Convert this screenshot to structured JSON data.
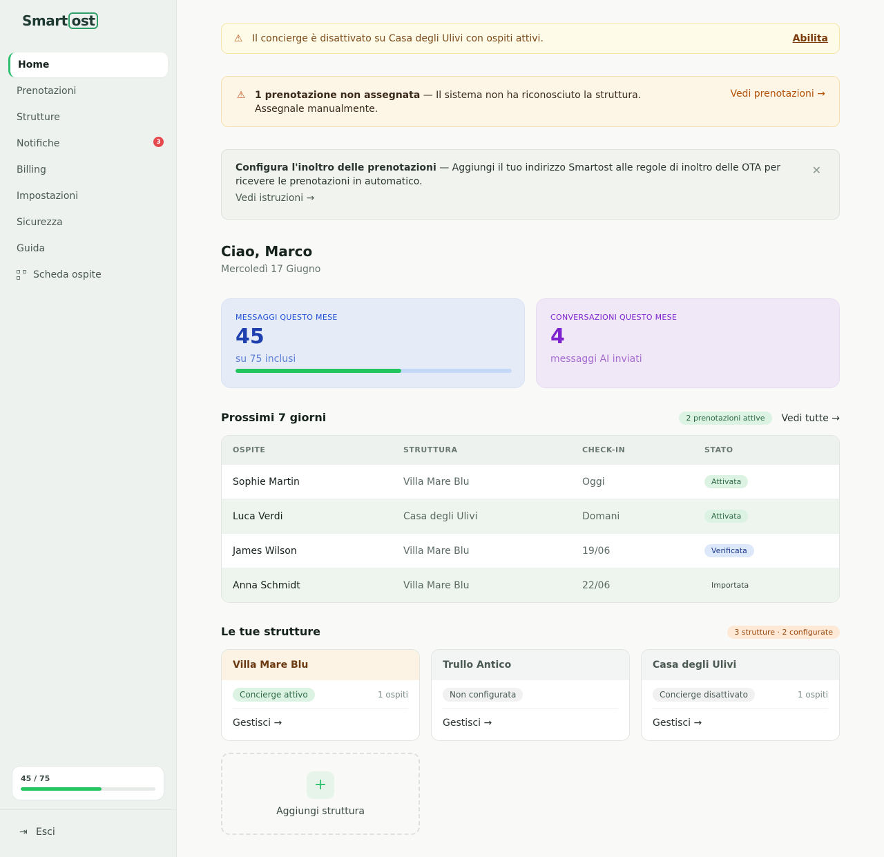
{
  "brand": {
    "name_part1": "Smart",
    "name_part2": "ost"
  },
  "sidebar": {
    "items": [
      {
        "label": "Home"
      },
      {
        "label": "Prenotazioni"
      },
      {
        "label": "Strutture"
      },
      {
        "label": "Notifiche",
        "badge": "3"
      },
      {
        "label": "Billing"
      },
      {
        "label": "Impostazioni"
      },
      {
        "label": "Sicurezza"
      },
      {
        "label": "Guida"
      },
      {
        "label": "Scheda ospite",
        "icon": "qr-code-icon"
      }
    ],
    "usage": {
      "label": "45 / 75",
      "used": 45,
      "total": 75
    },
    "logout_label": "Esci"
  },
  "alerts": {
    "concierge": {
      "text": "Il concierge è disattivato su Casa degli Ulivi con ospiti attivi.",
      "action": "Abilita"
    },
    "unassigned": {
      "bold": "1 prenotazione non assegnata",
      "text": " — Il sistema non ha riconosciuto la struttura. Assegnale manualmente.",
      "action": "Vedi prenotazioni →"
    },
    "forwarding": {
      "bold": "Configura l'inoltro delle prenotazioni",
      "text": " — Aggiungi il tuo indirizzo Smartost alle regole di inoltro delle OTA per ricevere le prenotazioni in automatico.",
      "action": "Vedi istruzioni →"
    }
  },
  "greeting": {
    "title": "Ciao, Marco",
    "date": "Mercoledì 17 Giugno"
  },
  "stats": {
    "messages": {
      "label": "MESSAGGI QUESTO MESE",
      "value": "45",
      "sub": "su 75 inclusi",
      "fraction": 0.6
    },
    "conversations": {
      "label": "CONVERSAZIONI QUESTO MESE",
      "value": "4",
      "sub": "messaggi AI inviati"
    }
  },
  "upcoming": {
    "title": "Prossimi 7 giorni",
    "badge": "2 prenotazioni attive",
    "see_all": "Vedi tutte →",
    "columns": [
      "OSPITE",
      "STRUTTURA",
      "CHECK-IN",
      "STATO"
    ],
    "rows": [
      {
        "guest": "Sophie Martin",
        "property": "Villa Mare Blu",
        "checkin": "Oggi",
        "status": "Attivata"
      },
      {
        "guest": "Luca Verdi",
        "property": "Casa degli Ulivi",
        "checkin": "Domani",
        "status": "Attivata"
      },
      {
        "guest": "James Wilson",
        "property": "Villa Mare Blu",
        "checkin": "19/06",
        "status": "Verificata"
      },
      {
        "guest": "Anna Schmidt",
        "property": "Villa Mare Blu",
        "checkin": "22/06",
        "status": "Importata"
      }
    ]
  },
  "properties": {
    "title": "Le tue strutture",
    "badge": "3 strutture · 2 configurate",
    "cards": [
      {
        "name": "Villa Mare Blu",
        "status": "Concierge attivo",
        "guests": "1 ospiti",
        "action": "Gestisci →"
      },
      {
        "name": "Trullo Antico",
        "status": "Non configurata",
        "guests": "",
        "action": "Gestisci →"
      },
      {
        "name": "Casa degli Ulivi",
        "status": "Concierge disattivato",
        "guests": "1 ospiti",
        "action": "Gestisci →"
      }
    ],
    "add_label": "Aggiungi struttura"
  }
}
